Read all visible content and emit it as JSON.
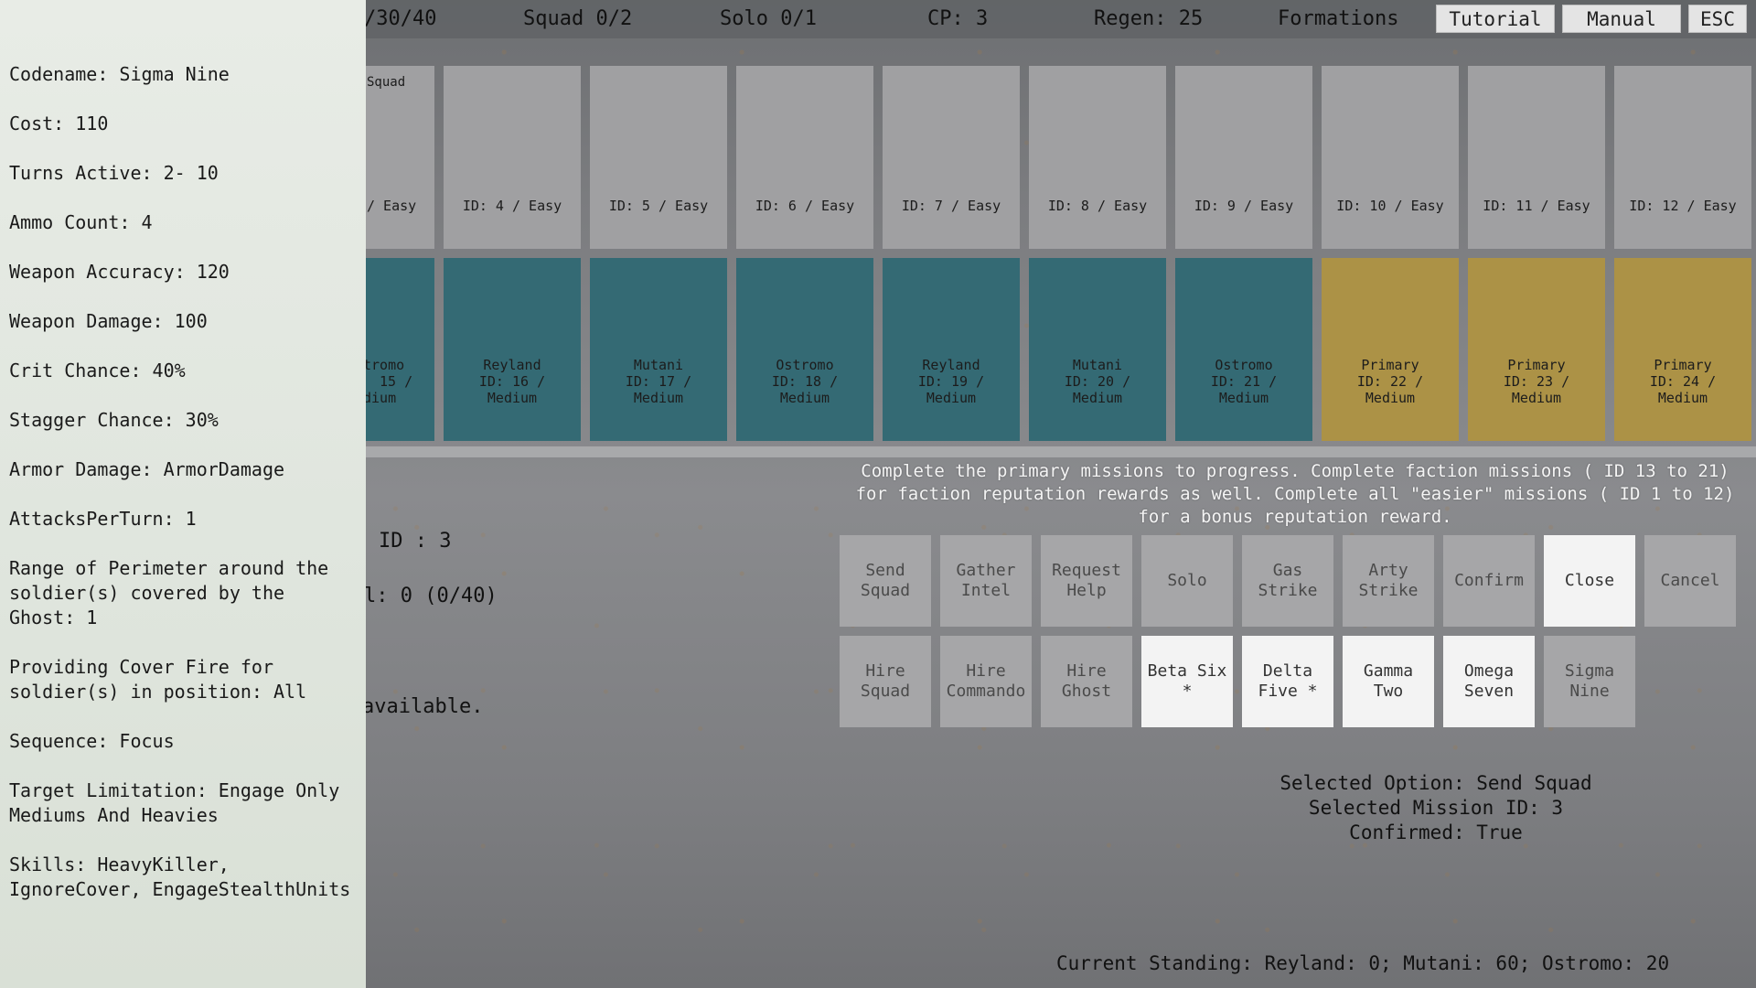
{
  "topbar": {
    "counter": "/30/40",
    "squad": "Squad 0/2",
    "solo": "Solo 0/1",
    "cp": "CP: 3",
    "regen": "Regen: 25",
    "formations": "Formations",
    "tutorial": "Tutorial",
    "manual": "Manual",
    "esc": "ESC"
  },
  "easy_cards": [
    {
      "top": "Squad",
      "label": "/ Easy"
    },
    {
      "label": "ID: 4 / Easy"
    },
    {
      "label": "ID: 5 / Easy"
    },
    {
      "label": "ID: 6 / Easy"
    },
    {
      "label": "ID: 7 / Easy"
    },
    {
      "label": "ID: 8 / Easy"
    },
    {
      "label": "ID: 9 / Easy"
    },
    {
      "label": "ID: 10 / Easy"
    },
    {
      "label": "ID: 11 / Easy"
    },
    {
      "label": "ID: 12 / Easy"
    }
  ],
  "medium_cards": [
    {
      "l1": "tromo",
      "l2": "15 /",
      "l3": "dium"
    },
    {
      "l1": "Reyland",
      "l2": "ID: 16 /",
      "l3": "Medium"
    },
    {
      "l1": "Mutani",
      "l2": "ID: 17 /",
      "l3": "Medium"
    },
    {
      "l1": "Ostromo",
      "l2": "ID: 18 /",
      "l3": "Medium"
    },
    {
      "l1": "Reyland",
      "l2": "ID: 19 /",
      "l3": "Medium"
    },
    {
      "l1": "Mutani",
      "l2": "ID: 20 /",
      "l3": "Medium"
    },
    {
      "l1": "Ostromo",
      "l2": "ID: 21 /",
      "l3": "Medium"
    },
    {
      "l1": "Primary",
      "l2": "ID: 22 /",
      "l3": "Medium"
    },
    {
      "l1": "Primary",
      "l2": "ID: 23 /",
      "l3": "Medium"
    },
    {
      "l1": "Primary",
      "l2": "ID: 24 /",
      "l3": "Medium"
    }
  ],
  "colors": {
    "faction_card": "#346a74",
    "primary_card": "#ac9246",
    "easy_card": "#a0a0a2"
  },
  "mission": {
    "id_text": "ID : 3",
    "slots_text": "l: 0 (0/40)",
    "available_text": "available."
  },
  "info": {
    "line1": "Complete the primary missions to progress. Complete faction missions ( ID 13 to 21)",
    "line2": "for faction reputation rewards as well. Complete all \"easier\" missions ( ID 1 to 12)",
    "line3": "for a bonus reputation reward."
  },
  "actions_row1": [
    {
      "l1": "Send",
      "l2": "Squad"
    },
    {
      "l1": "Gather",
      "l2": "Intel"
    },
    {
      "l1": "Request",
      "l2": "Help"
    },
    {
      "l1": "Solo",
      "l2": ""
    },
    {
      "l1": "Gas",
      "l2": "Strike"
    },
    {
      "l1": "Arty",
      "l2": "Strike"
    },
    {
      "l1": "Confirm",
      "l2": ""
    },
    {
      "l1": "Close",
      "l2": ""
    },
    {
      "l1": "Cancel",
      "l2": ""
    }
  ],
  "actions_row2": [
    {
      "l1": "Hire",
      "l2": "Squad"
    },
    {
      "l1": "Hire",
      "l2": "Commando"
    },
    {
      "l1": "Hire",
      "l2": "Ghost"
    },
    {
      "l1": "Beta Six",
      "l2": "*"
    },
    {
      "l1": "Delta",
      "l2": "Five *"
    },
    {
      "l1": "Gamma Two",
      "l2": ""
    },
    {
      "l1": "Omega",
      "l2": "Seven"
    },
    {
      "l1": "Sigma",
      "l2": "Nine"
    }
  ],
  "status": {
    "selected_option": "Selected Option: Send Squad",
    "selected_mission": "Selected Mission ID: 3",
    "confirmed": "Confirmed: True"
  },
  "standing": "Current Standing: Reyland: 0; Mutani: 60; Ostromo: 20",
  "panel": {
    "codename": "Codename: Sigma Nine",
    "cost": "Cost: 110",
    "turns": "Turns Active: 2- 10",
    "ammo": "Ammo Count: 4",
    "accuracy": "Weapon Accuracy: 120",
    "damage": "Weapon Damage: 100",
    "crit": "Crit Chance: 40%",
    "stagger": "Stagger Chance: 30%",
    "armor": "Armor Damage: ArmorDamage",
    "attacks": "AttacksPerTurn: 1",
    "range": "Range of Perimeter around the soldier(s) covered by the Ghost: 1",
    "cover": "Providing Cover Fire for soldier(s) in position: All",
    "sequence": "Sequence: Focus",
    "target": "Target Limitation: Engage Only Mediums And Heavies",
    "skills": "Skills: HeavyKiller, IgnoreCover, EngageStealthUnits"
  }
}
